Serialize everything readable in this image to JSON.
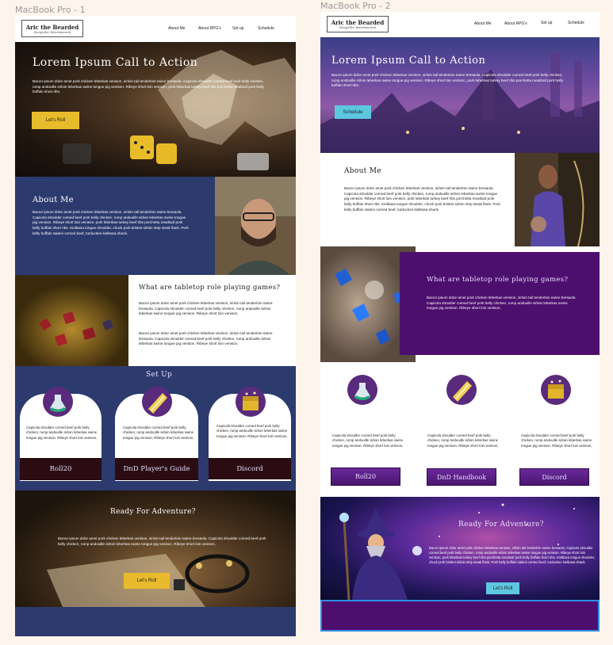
{
  "frames": [
    {
      "label": "MacBook Pro - 1",
      "logo": {
        "name": "Aric the Bearded",
        "tagline": "Storyteller. Entertainment"
      },
      "nav": [
        "About Me",
        "About RPG's",
        "Set up",
        "Schedule"
      ],
      "hero": {
        "title": "Lorem Ipsum Call to Action",
        "text": "Bacon ipsum dolor amet pork chicken leberkas venison, sirloin tail tenderloin swine bresaola. Capicola shoulder corned beef pork belly chicken, rump andouille sirloin leberkas swine tongue pig venison. Ribeye short loin venison, pork leberkas turkey beef ribs porchetta meatloaf pork belly buffalo short ribs.",
        "button": "Let's Roll"
      },
      "about": {
        "title": "About Me",
        "text": "Bacon ipsum dolor amet pork chicken leberkas venison, sirloin tail tenderloin swine bresaola. Capicola shoulder corned beef pork belly chicken, rump andouille sirloin leberkas swine tongue pig venison. Ribeye short loin venison, pork leberkas turkey beef ribs porchetta meatloaf pork belly buffalo short ribs. Kielbasa tongue shoulder, chuck pork brisket sirloin strip steak flank. Pork belly buffalo salami corned beef, turducken kielbasa shank."
      },
      "rpg": {
        "title": "What are tabletop role playing games?",
        "p1": "Bacon ipsum dolor amet pork chicken leberkas venison, sirloin tail tenderloin swine bresaola. Capicola shoulder corned beef pork belly chicken, rump andouille sirloin leberkas swine tongue pig venison. Ribeye short loin venison,",
        "p2": "Bacon ipsum dolor amet pork chicken leberkas venison, sirloin tail tenderloin swine bresaola. Capicola shoulder corned beef pork belly chicken, rump andouille sirloin leberkas swine tongue pig venison. Ribeye short loin venison,"
      },
      "setup": {
        "title": "Set Up",
        "cards": [
          {
            "icon": "potion-icon",
            "text": "Capicola shoulder corned beef pork belly chicken, rump andouille sirloin leberkas swine tongue pig venison. Ribeye short loin venison,",
            "label": "Roll20"
          },
          {
            "icon": "scroll-icon",
            "text": "Capicola shoulder corned beef pork belly chicken, rump andouille sirloin leberkas swine tongue pig venison. Ribeye short loin venison,",
            "label": "DnD Player's Guide"
          },
          {
            "icon": "treasure-chest-icon",
            "text": "Capicola shoulder corned beef pork belly chicken, rump andouille sirloin leberkas swine tongue pig venison. Ribeye short loin venison,",
            "label": "Discord"
          }
        ]
      },
      "adventure": {
        "title": "Ready For Adventure?",
        "text": "Bacon ipsum dolor amet pork chicken leberkas venison, sirloin tail tenderloin swine bresaola. Capicola shoulder corned beef pork belly chicken, rump andouille sirloin leberkas swine tongue pig venison. Ribeye short loin venison,",
        "button": "Let's Roll"
      }
    },
    {
      "label": "MacBook Pro - 2",
      "logo": {
        "name": "Aric the Bearded",
        "tagline": "Storyteller. Entertainment"
      },
      "nav": [
        "About Me",
        "About RPG's",
        "Set up",
        "Schedule"
      ],
      "hero": {
        "title": "Lorem Ipsum Call to Action",
        "text": "Bacon ipsum dolor amet pork chicken leberkas venison, sirloin tail tenderloin swine bresaola. Capicola shoulder corned beef pork belly chicken, rump andouille sirloin leberkas swine tongue pig venison. Ribeye short loin venison, pork leberkas turkey beef ribs porchetta meatloaf pork belly buffalo short ribs.",
        "button": "Schedule"
      },
      "about": {
        "title": "About Me",
        "text": "Bacon ipsum dolor amet pork chicken leberkas venison, sirloin tail tenderloin swine bresaola. Capicola shoulder corned beef pork belly chicken, rump andouille sirloin leberkas swine tongue pig venison. Ribeye short loin venison, pork leberkas turkey beef ribs porchetta meatloaf pork belly buffalo short ribs. Kielbasa tongue shoulder, chuck pork brisket sirloin strip steak flank. Pork belly buffalo salami corned beef, turducken kielbasa shank."
      },
      "rpg": {
        "title": "What are tabletop role playing games?",
        "text": "Bacon ipsum dolor amet pork chicken leberkas venison, sirloin tail tenderloin swine bresaola. Capicola shoulder corned beef pork belly chicken, rump andouille sirloin leberkas swine tongue pig venison. Ribeye short loin venison,"
      },
      "setup": {
        "cards": [
          {
            "icon": "potion-icon",
            "text": "Capicola shoulder corned beef pork belly chicken, rump andouille sirloin leberkas swine tongue pig venison. Ribeye short loin venison,",
            "label": "Roll20"
          },
          {
            "icon": "scroll-icon",
            "text": "Capicola shoulder corned beef pork belly chicken, rump andouille sirloin leberkas swine tongue pig venison. Ribeye short loin venison,",
            "label": "DnD Handbook"
          },
          {
            "icon": "treasure-chest-icon",
            "text": "Capicola shoulder corned beef pork belly chicken, rump andouille sirloin leberkas swine tongue pig venison. Ribeye short loin venison,",
            "label": "Discord"
          }
        ]
      },
      "adventure": {
        "title": "Ready For Adventure?",
        "text": "Bacon ipsum dolor amet pork chicken leberkas venison, sirloin tail tenderloin swine bresaola. Capicola shoulder corned beef pork belly chicken, rump andouille sirloin leberkas swine tongue pig venison. Ribeye short loin venison, pork leberkas turkey beef ribs porchetta meatloaf pork belly buffalo short ribs. Kielbasa tongue shoulder, chuck pork brisket sirloin strip steak flank. Pork belly buffalo salami corned beef, turducken kielbasa shank.",
        "button": "Let's Roll"
      }
    }
  ],
  "colors": {
    "canvas": "#fdf4ec",
    "navy": "#2c3a6e",
    "purple": "#4d0f6e",
    "yellow_button": "#e8bb2c",
    "cyan_button": "#5ec7e0",
    "card_footer": "#2a0c12",
    "selection": "#2f8ee6"
  }
}
